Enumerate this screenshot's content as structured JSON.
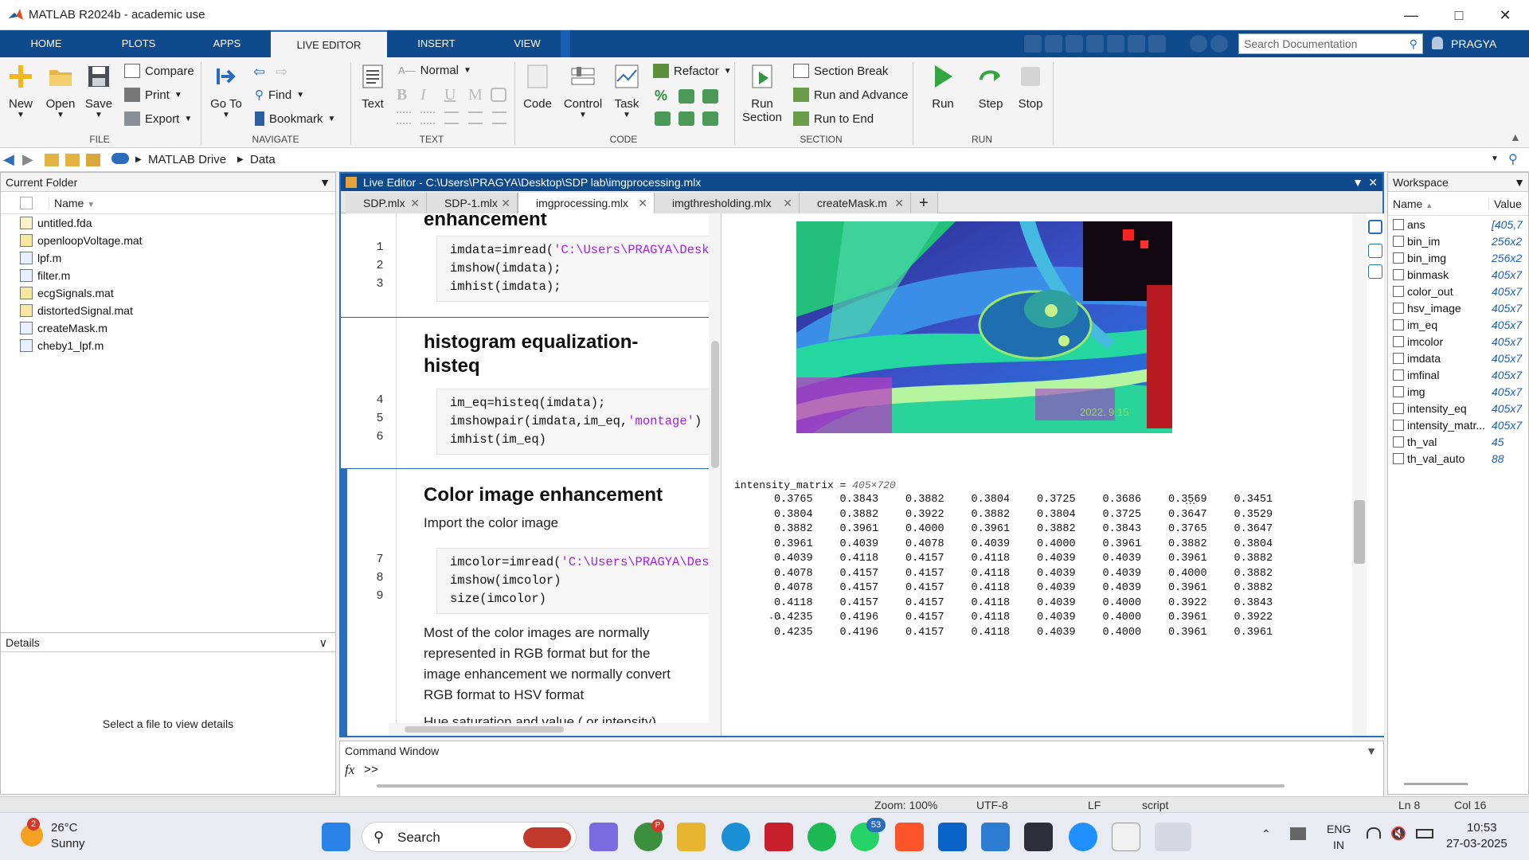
{
  "window": {
    "title": "MATLAB R2024b - academic use"
  },
  "tabs": [
    "HOME",
    "PLOTS",
    "APPS",
    "LIVE EDITOR",
    "INSERT",
    "VIEW"
  ],
  "active_tab": "LIVE EDITOR",
  "search": {
    "placeholder": "Search Documentation"
  },
  "user": "PRAGYA",
  "ribbon": {
    "file": {
      "new": "New",
      "open": "Open",
      "save": "Save",
      "compare": "Compare",
      "print": "Print",
      "export": "Export",
      "group": "FILE"
    },
    "navigate": {
      "goto": "Go To",
      "find": "Find",
      "bookmark": "Bookmark",
      "group": "NAVIGATE"
    },
    "text": {
      "style": "Normal",
      "text": "Text",
      "bold": "B",
      "italic": "I",
      "underline": "U",
      "mono": "M",
      "group": "TEXT"
    },
    "code": {
      "code": "Code",
      "control": "Control",
      "task": "Task",
      "refactor": "Refactor",
      "group": "CODE"
    },
    "section": {
      "run_section": "Run",
      "run_section2": "Section",
      "section_break": "Section Break",
      "run_advance": "Run and Advance",
      "run_end": "Run to End",
      "group": "SECTION"
    },
    "run": {
      "run": "Run",
      "step": "Step",
      "stop": "Stop",
      "group": "RUN"
    }
  },
  "address": {
    "drive": "MATLAB Drive",
    "folder": "Data"
  },
  "current_folder": {
    "title": "Current Folder",
    "col_name": "Name",
    "files": [
      "untitled.fda",
      "openloopVoltage.mat",
      "lpf.m",
      "filter.m",
      "ecgSignals.mat",
      "distortedSignal.mat",
      "createMask.m",
      "cheby1_lpf.m"
    ]
  },
  "details": {
    "title": "Details",
    "empty": "Select a file to view details"
  },
  "editor": {
    "title": "Live Editor - C:\\Users\\PRAGYA\\Desktop\\SDP lab\\imgprocessing.mlx",
    "files": [
      "SDP.mlx",
      "SDP-1.mlx",
      "imgprocessing.mlx",
      "imgthresholding.mlx",
      "createMask.m"
    ],
    "active_file": "imgprocessing.mlx",
    "heading_top": "enhancement",
    "heading1": "histogram equalization-",
    "heading1b": "histeq",
    "heading2": "Color image enhancement",
    "para1": "Import the color image",
    "para2a": "Most of the color images are normally",
    "para2b": "represented in RGB format but for the",
    "para2c": "image enhancement we normally convert",
    "para2d": "RGB format to HSV format",
    "para3": "Hue saturation and value ( or intensity)",
    "lines": [
      "1",
      "2",
      "3",
      "4",
      "5",
      "6",
      "7",
      "8",
      "9"
    ],
    "block1": [
      "imdata=imread(",
      "'C:\\Users\\PRAGYA\\Deskt",
      "imshow(imdata);",
      "imhist(imdata);"
    ],
    "block2": [
      "im_eq=histeq(imdata);",
      "imshowpair(imdata,im_eq,",
      "'montage'",
      ")",
      "imhist(im_eq)"
    ],
    "block3": [
      "imcolor=imread(",
      "'C:\\Users\\PRAGYA\\Desk",
      "imshow(imcolor)",
      "size(imcolor)"
    ]
  },
  "output": {
    "image_caption": "2022. 9.15",
    "matrix_label": "intensity_matrix = ",
    "matrix_size": "405×720",
    "ellipsis": "...",
    "matrix": [
      [
        "0.3765",
        "0.3843",
        "0.3882",
        "0.3804",
        "0.3725",
        "0.3686",
        "0.3569",
        "0.3451"
      ],
      [
        "0.3804",
        "0.3882",
        "0.3922",
        "0.3882",
        "0.3804",
        "0.3725",
        "0.3647",
        "0.3529"
      ],
      [
        "0.3882",
        "0.3961",
        "0.4000",
        "0.3961",
        "0.3882",
        "0.3843",
        "0.3765",
        "0.3647"
      ],
      [
        "0.3961",
        "0.4039",
        "0.4078",
        "0.4039",
        "0.4000",
        "0.3961",
        "0.3882",
        "0.3804"
      ],
      [
        "0.4039",
        "0.4118",
        "0.4157",
        "0.4118",
        "0.4039",
        "0.4039",
        "0.3961",
        "0.3882"
      ],
      [
        "0.4078",
        "0.4157",
        "0.4157",
        "0.4118",
        "0.4039",
        "0.4039",
        "0.4000",
        "0.3882"
      ],
      [
        "0.4078",
        "0.4157",
        "0.4157",
        "0.4118",
        "0.4039",
        "0.4039",
        "0.3961",
        "0.3882"
      ],
      [
        "0.4118",
        "0.4157",
        "0.4157",
        "0.4118",
        "0.4039",
        "0.4000",
        "0.3922",
        "0.3843"
      ],
      [
        "0.4235",
        "0.4196",
        "0.4157",
        "0.4118",
        "0.4039",
        "0.4000",
        "0.3961",
        "0.3922"
      ],
      [
        "0.4235",
        "0.4196",
        "0.4157",
        "0.4118",
        "0.4039",
        "0.4000",
        "0.3961",
        "0.3961"
      ]
    ]
  },
  "command_window": {
    "title": "Command Window",
    "fx": "fx",
    "prompt": ">>"
  },
  "workspace": {
    "title": "Workspace",
    "col_name": "Name",
    "col_value": "Value",
    "vars": [
      {
        "name": "ans",
        "value": "[405,7"
      },
      {
        "name": "bin_im",
        "value": "256x2"
      },
      {
        "name": "bin_img",
        "value": "256x2"
      },
      {
        "name": "binmask",
        "value": "405x7"
      },
      {
        "name": "color_out",
        "value": "405x7"
      },
      {
        "name": "hsv_image",
        "value": "405x7"
      },
      {
        "name": "im_eq",
        "value": "405x7"
      },
      {
        "name": "imcolor",
        "value": "405x7"
      },
      {
        "name": "imdata",
        "value": "405x7"
      },
      {
        "name": "imfinal",
        "value": "405x7"
      },
      {
        "name": "img",
        "value": "405x7"
      },
      {
        "name": "intensity_eq",
        "value": "405x7"
      },
      {
        "name": "intensity_matr...",
        "value": "405x7"
      },
      {
        "name": "th_val",
        "value": "45"
      },
      {
        "name": "th_val_auto",
        "value": "88"
      }
    ]
  },
  "statusbar": {
    "zoom": "Zoom: 100%",
    "enc": "UTF-8",
    "eol": "LF",
    "type": "script",
    "ln": "Ln  8",
    "col": "Col  16"
  },
  "taskbar": {
    "weather_temp": "26°C",
    "weather_desc": "Sunny",
    "weather_badge": "2",
    "search": "Search",
    "chrome_badge": "P",
    "whatsapp_badge": "53",
    "lang1": "ENG",
    "lang2": "IN",
    "time": "10:53",
    "date": "27-03-2025"
  }
}
